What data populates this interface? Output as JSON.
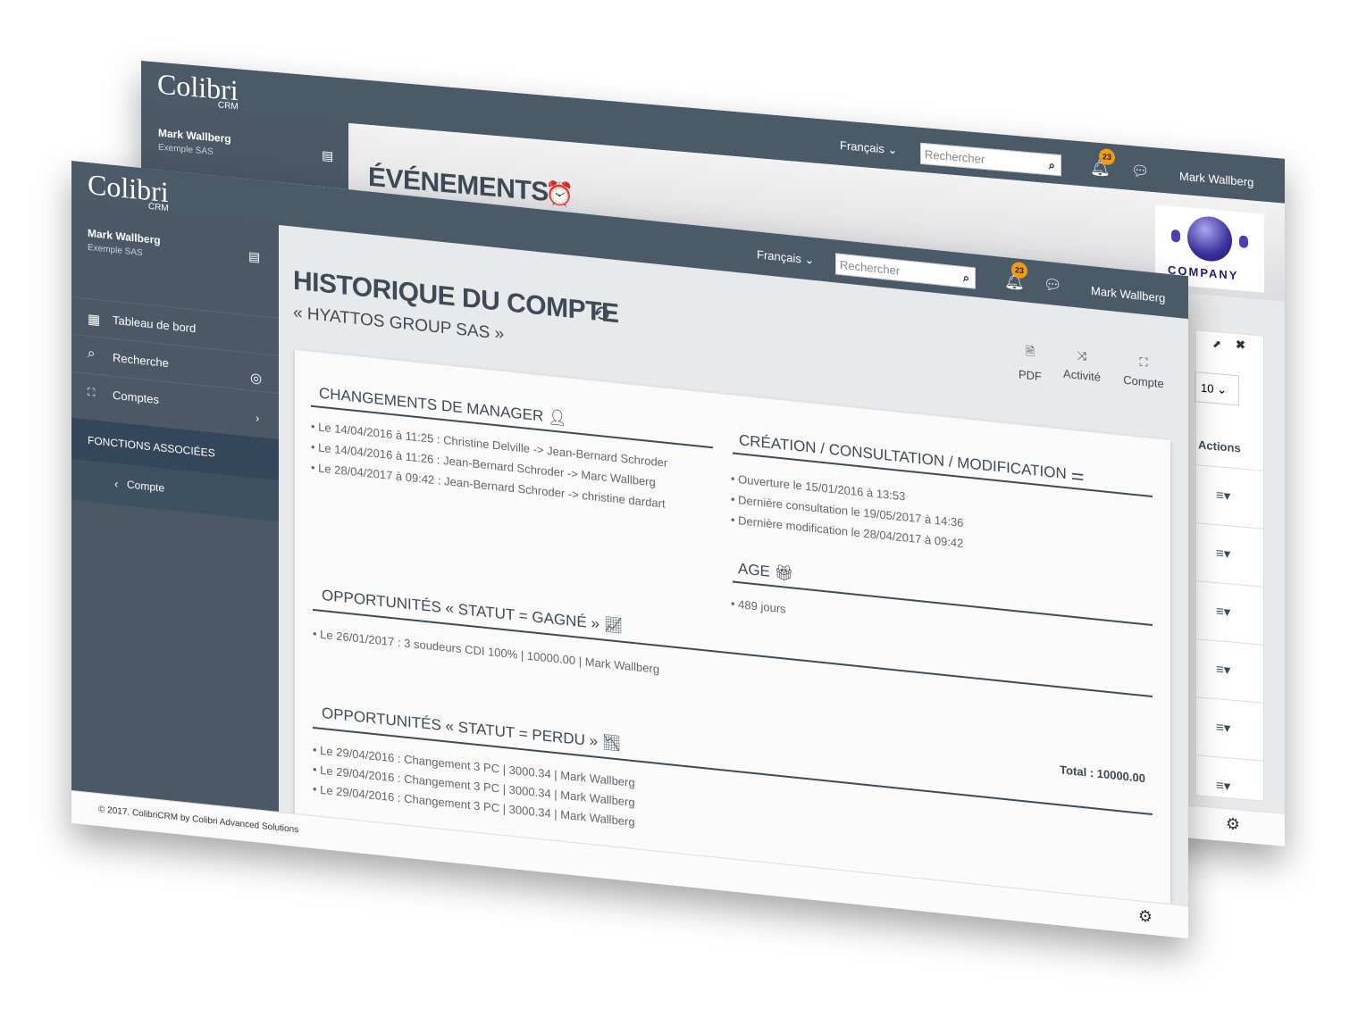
{
  "colors": {
    "header": "#4b5a68",
    "sidebar": "#4b5866",
    "sidebar_active": "#2f4152",
    "badge": "#f39c12",
    "title": "#3e4a56"
  },
  "back_window": {
    "logo": {
      "name": "Colibri",
      "sub": "CRM"
    },
    "user": {
      "name": "Mark Wallberg",
      "company": "Exemple SAS"
    },
    "header": {
      "language": "Français",
      "search_placeholder": "Rechercher",
      "notifications": "23",
      "user": "Mark Wallberg"
    },
    "page_title": "ÉVÉNEMENTS",
    "company_logo_text": "COMPANY",
    "widget": {
      "page_size": "10",
      "actions_header": "Actions",
      "row_count": 6
    }
  },
  "front_window": {
    "logo": {
      "name": "Colibri",
      "sub": "CRM"
    },
    "user": {
      "name": "Mark Wallberg",
      "company": "Exemple SAS"
    },
    "menu": [
      {
        "label": "Tableau de bord",
        "icon": "dashboard-icon"
      },
      {
        "label": "Recherche",
        "icon": "search-icon"
      },
      {
        "label": "Comptes",
        "icon": "accounts-icon"
      }
    ],
    "section_label": "FONCTIONS ASSOCIÉES",
    "sub_item": "Compte",
    "header": {
      "language": "Français",
      "search_placeholder": "Rechercher",
      "notifications": "23",
      "user": "Mark Wallberg"
    },
    "page_title": "HISTORIQUE DU COMPTE",
    "page_subtitle": "« HYATTOS GROUP SAS »",
    "toolbar": {
      "pdf": "PDF",
      "activity": "Activité",
      "account": "Compte"
    },
    "managers": {
      "title": "CHANGEMENTS DE MANAGER",
      "items": [
        "Le 14/04/2016 à 11:25 : Christine Delville -> Jean-Bernard Schroder",
        "Le 14/04/2016 à 11:26 : Jean-Bernard Schroder -> Marc Wallberg",
        "Le 28/04/2017 à 09:42 : Jean-Bernard Schroder -> christine dardart"
      ]
    },
    "creation": {
      "title": "CRÉATION / CONSULTATION / MODIFICATION",
      "items": [
        "Ouverture le 15/01/2016 à 13:53",
        "Dernière consultation le 19/05/2017 à 14:36",
        "Dernière modification le 28/04/2017 à 09:42"
      ]
    },
    "age": {
      "title": "AGE",
      "items": [
        "489 jours"
      ]
    },
    "won": {
      "title": "OPPORTUNITÉS « STATUT = GAGNÉ »",
      "items": [
        "Le 26/01/2017 : 3 soudeurs CDI 100% | 10000.00 | Mark Wallberg"
      ],
      "total": "Total : 10000.00"
    },
    "lost": {
      "title": "OPPORTUNITÉS « STATUT = PERDU »",
      "items": [
        "Le 29/04/2016 : Changement 3 PC | 3000.34 | Mark Wallberg",
        "Le 29/04/2016 : Changement 3 PC | 3000.34 | Mark Wallberg",
        "Le 29/04/2016 : Changement 3 PC | 3000.34 | Mark Wallberg"
      ]
    },
    "footer": "© 2017. ColibriCRM by Colibri Advanced Solutions"
  }
}
